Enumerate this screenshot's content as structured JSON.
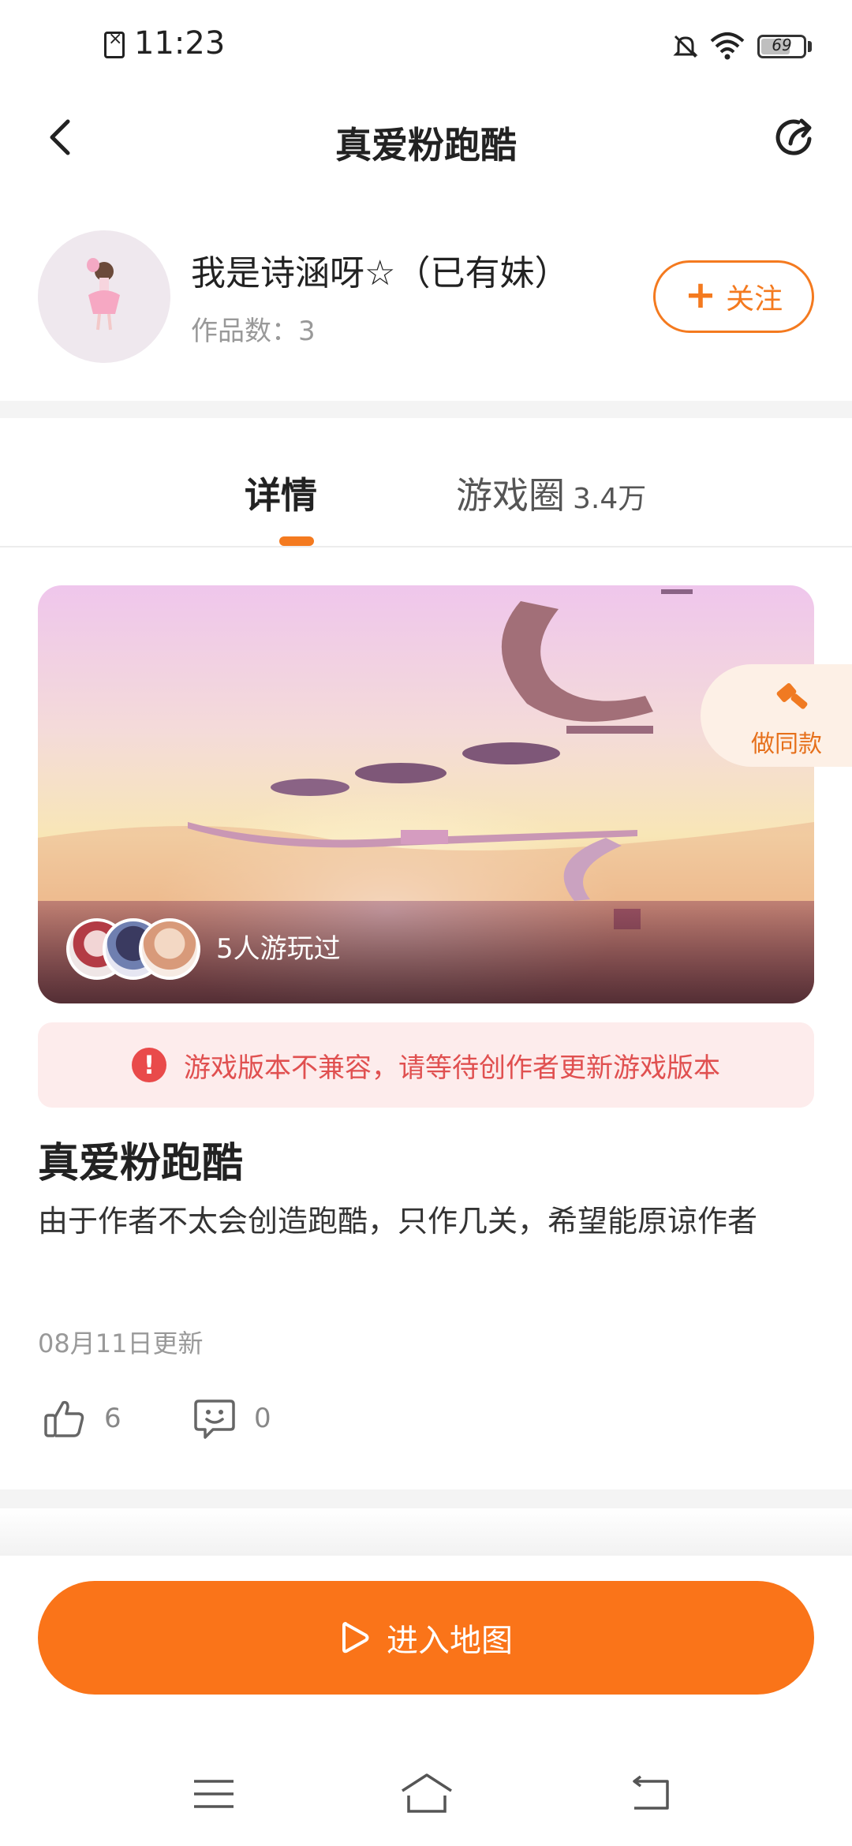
{
  "status_bar": {
    "time": "11:23",
    "battery": "69",
    "battery_level": 0.69
  },
  "header": {
    "title": "真爱粉跑酷",
    "back_icon": "chevron-left-icon",
    "share_icon": "share-icon"
  },
  "author": {
    "name": "我是诗涵呀☆（已有妹）",
    "works_label": "作品数：3",
    "follow_label": "关注"
  },
  "tabs": [
    {
      "label": "详情",
      "active": true
    },
    {
      "label": "游戏圈",
      "count": "3.4万",
      "active": false
    }
  ],
  "cover": {
    "players_text": "5人游玩过",
    "make_same_label": "做同款"
  },
  "warning": {
    "text": "游戏版本不兼容，请等待创作者更新游戏版本"
  },
  "game": {
    "title": "真爱粉跑酷",
    "description": "由于作者不太会创造跑酷，只作几关，希望能原谅作者",
    "updated": "08月11日更新",
    "likes": "6",
    "comments": "0"
  },
  "action": {
    "enter_label": "进入地图"
  },
  "colors": {
    "accent": "#fa7419",
    "warning_text": "#e05050",
    "warning_bg": "#fdecec"
  }
}
